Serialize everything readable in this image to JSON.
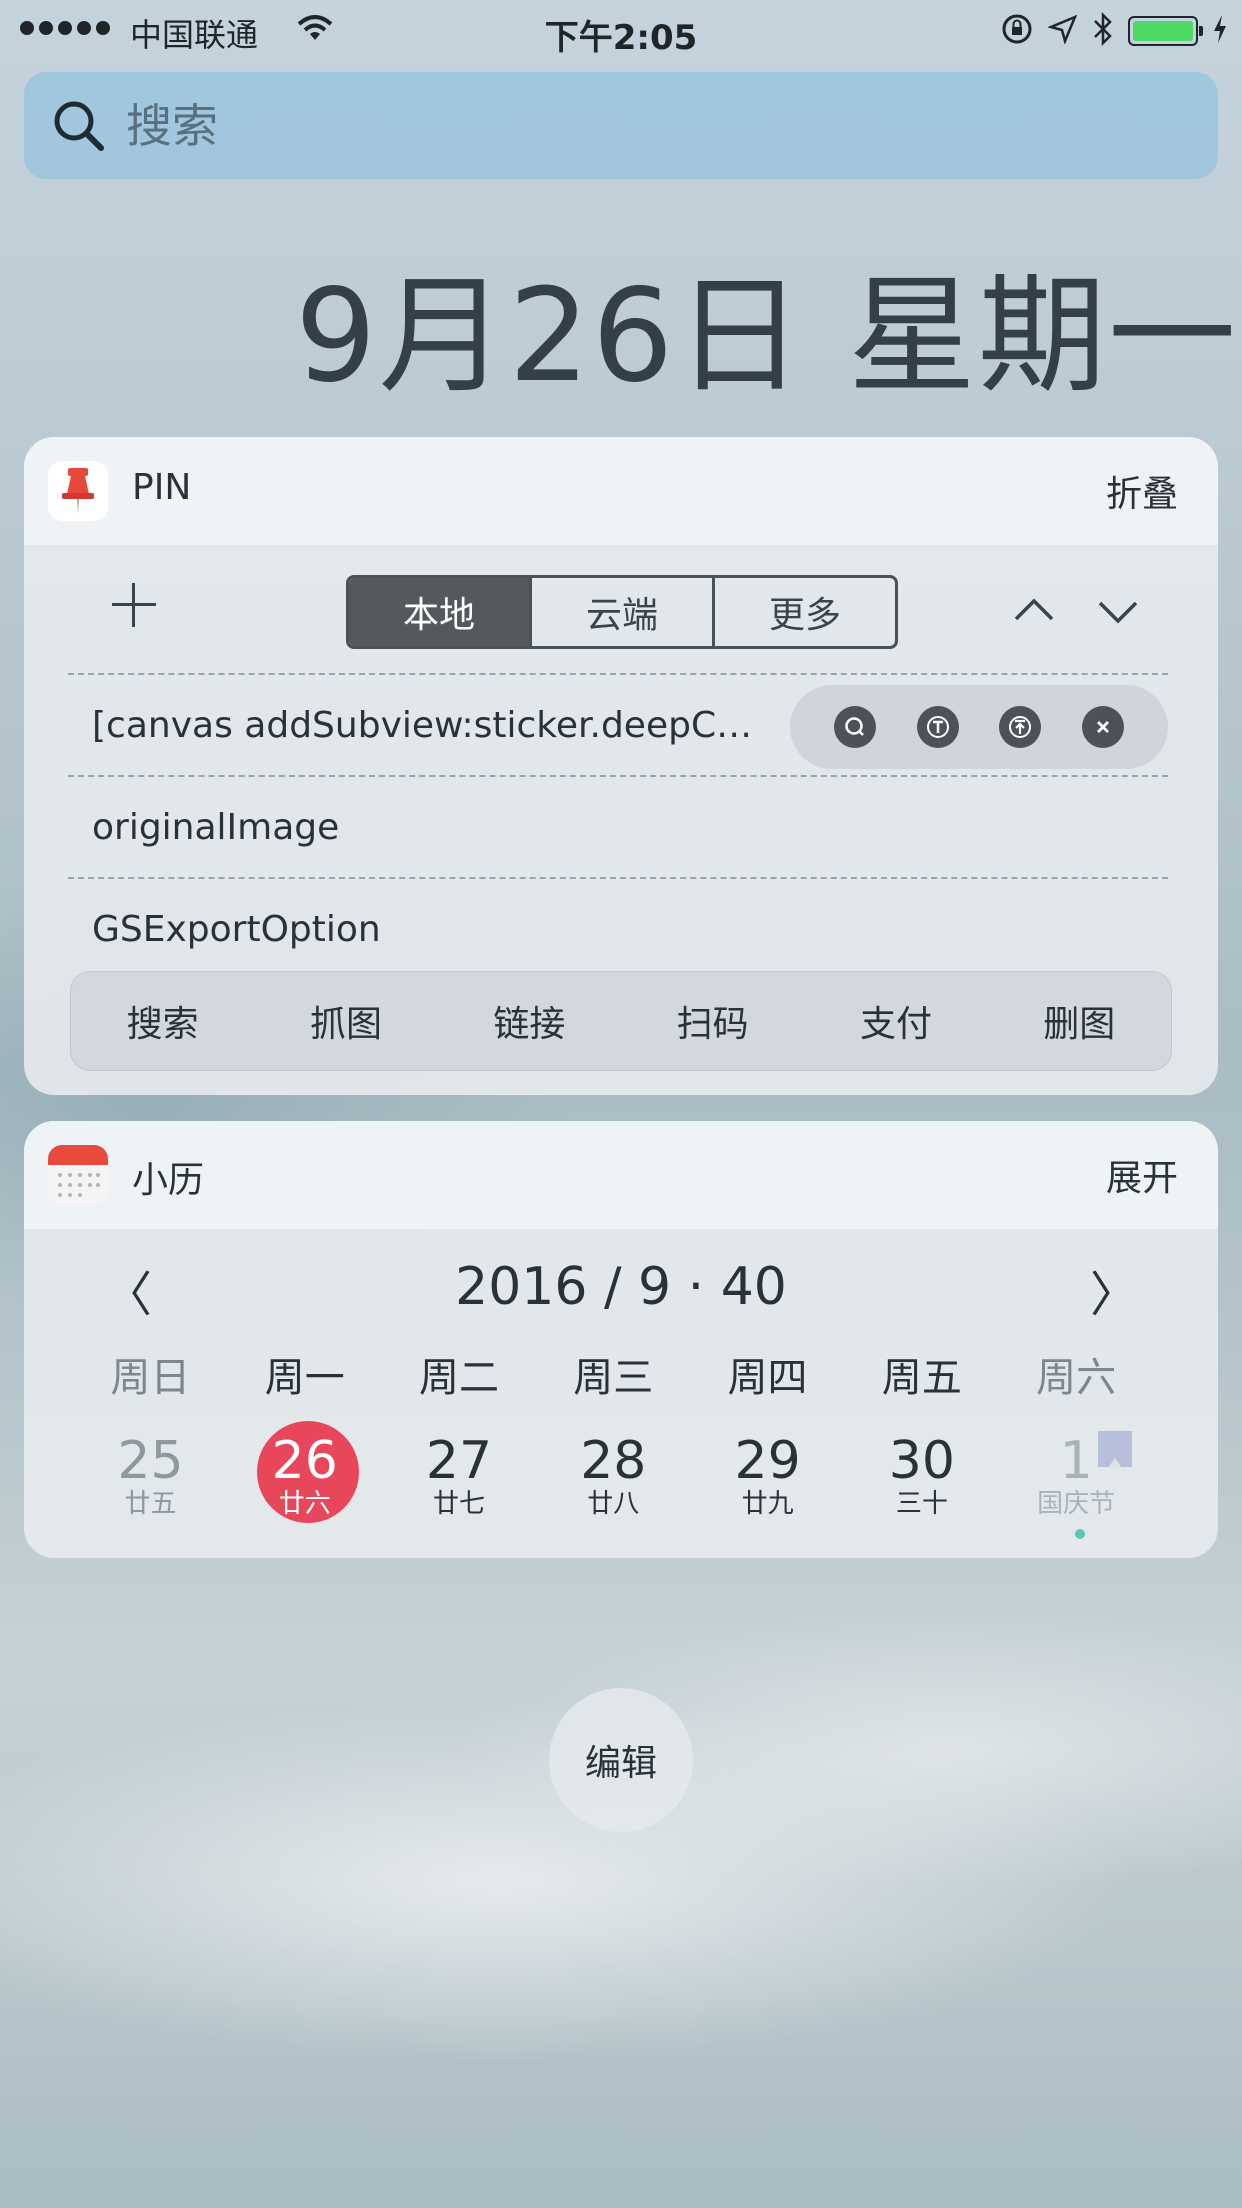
{
  "status_bar": {
    "carrier": "中国联通",
    "time": "下午2:05",
    "battery_color": "#4cd964"
  },
  "search": {
    "placeholder": "搜索"
  },
  "date_header": "9月26日 星期一",
  "pin_widget": {
    "title": "PIN",
    "collapse_label": "折叠",
    "segments": [
      "本地",
      "云端",
      "更多"
    ],
    "selected_segment": "本地",
    "items": [
      "[canvas addSubview:sticker.deepCopy]",
      "originalImage",
      "GSExportOption"
    ],
    "row_action_icons": [
      "search-icon",
      "text-icon",
      "pin-top-icon",
      "close-icon"
    ],
    "tools": [
      "搜索",
      "抓图",
      "链接",
      "扫码",
      "支付",
      "删图"
    ]
  },
  "calendar_widget": {
    "title": "小历",
    "expand_label": "展开",
    "prev_label": "〈",
    "next_label": "〉",
    "month_title": "2016 / 9 · 40",
    "weekdays": [
      "周日",
      "周一",
      "周二",
      "周三",
      "周四",
      "周五",
      "周六"
    ],
    "days": [
      {
        "num": "25",
        "lunar": "廿五"
      },
      {
        "num": "26",
        "lunar": "廿六"
      },
      {
        "num": "27",
        "lunar": "廿七"
      },
      {
        "num": "28",
        "lunar": "廿八"
      },
      {
        "num": "29",
        "lunar": "廿九"
      },
      {
        "num": "30",
        "lunar": "三十"
      },
      {
        "num": "1",
        "lunar": "国庆节"
      }
    ],
    "today_color": "#e8475b"
  },
  "edit_label": "编辑"
}
